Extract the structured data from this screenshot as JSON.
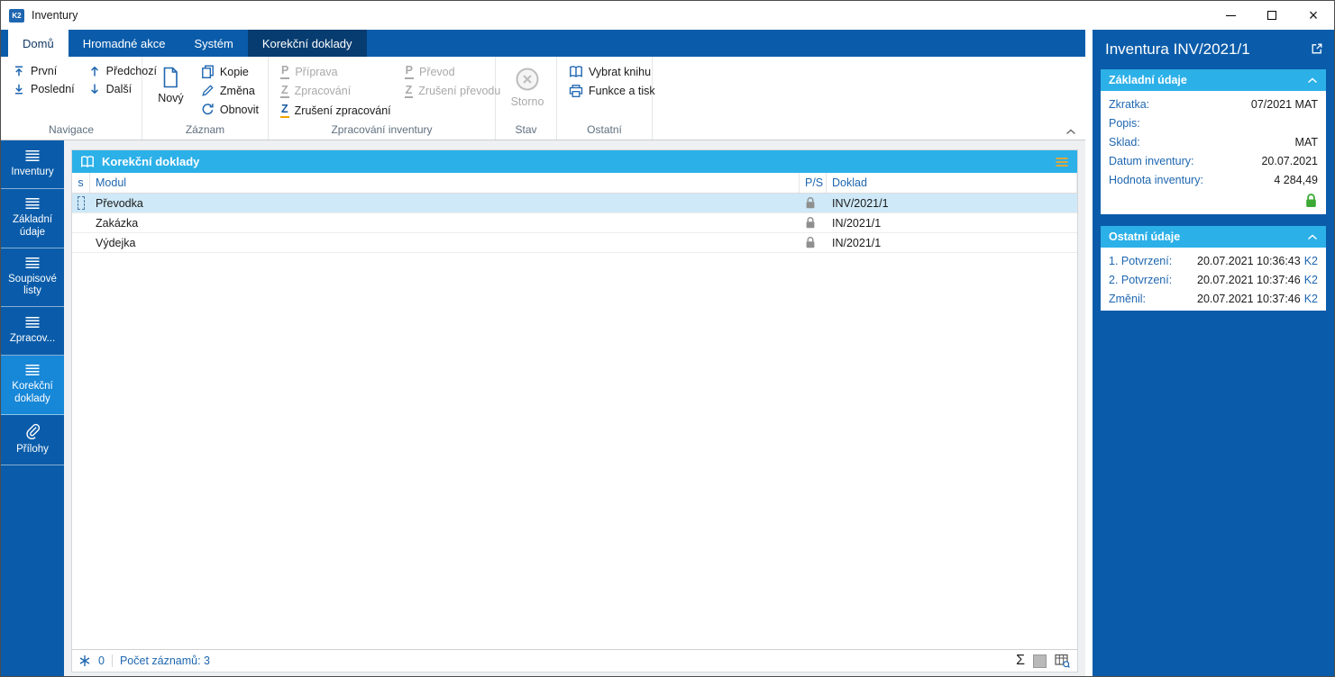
{
  "window": {
    "title": "Inventury"
  },
  "colors": {
    "primary_blue": "#0a5caa",
    "contextual_tab": "#063c70",
    "cyan_header": "#2cb0e8",
    "selected_row": "#cfe9f8",
    "link_blue": "#1e66b0",
    "sidebar_active": "#1787d8",
    "lock_green": "#3aaa35",
    "hamburger_orange": "#f5a623"
  },
  "icons": {
    "letter_p": "P",
    "letter_z": "Z",
    "sum": "Σ"
  },
  "tabs": [
    {
      "label": "Domů",
      "active": true
    },
    {
      "label": "Hromadné akce"
    },
    {
      "label": "Systém"
    },
    {
      "label": "Korekční doklady",
      "contextual": true
    }
  ],
  "ribbon": {
    "navigace": {
      "label": "Navigace",
      "first": "První",
      "last": "Poslední",
      "prev": "Předchozí",
      "next": "Další"
    },
    "zaznam": {
      "label": "Záznam",
      "novy": "Nový",
      "kopie": "Kopie",
      "zmena": "Změna",
      "obnovit": "Obnovit"
    },
    "zpracovani": {
      "label": "Zpracování inventury",
      "priprava": "Příprava",
      "zprac": "Zpracování",
      "zruseni_zprac": "Zrušení zpracování",
      "prevod": "Převod",
      "zruseni_prevodu": "Zrušení převodu"
    },
    "stav": {
      "label": "Stav",
      "storno": "Storno"
    },
    "ostatni": {
      "label": "Ostatní",
      "vybrat_knihu": "Vybrat knihu",
      "funkce_a_tisk": "Funkce a tisk"
    }
  },
  "sidebar": {
    "items": [
      {
        "label": "Inventury"
      },
      {
        "label": "Základní údaje"
      },
      {
        "label": "Soupisové listy"
      },
      {
        "label": "Zpracov..."
      },
      {
        "label": "Korekční doklady",
        "active": true
      },
      {
        "label": "Přílohy"
      }
    ]
  },
  "grid": {
    "title": "Korekční doklady",
    "columns": {
      "s": "s",
      "modul": "Modul",
      "ps": "P/S",
      "doklad": "Doklad"
    },
    "rows": [
      {
        "modul": "Převodka",
        "doklad": "INV/2021/1",
        "locked": true,
        "selected": true
      },
      {
        "modul": "Zakázka",
        "doklad": "IN/2021/1",
        "locked": true
      },
      {
        "modul": "Výdejka",
        "doklad": "IN/2021/1",
        "locked": true
      }
    ],
    "status": {
      "flag_count": "0",
      "records": "Počet záznamů: 3"
    }
  },
  "detail": {
    "title": "Inventura INV/2021/1",
    "sections": [
      {
        "header": "Základní údaje",
        "locked": true,
        "rows": [
          {
            "label": "Zkratka:",
            "value": "07/2021 MAT"
          },
          {
            "label": "Popis:",
            "value": ""
          },
          {
            "label": "Sklad:",
            "value": "MAT"
          },
          {
            "label": "Datum inventury:",
            "value": "20.07.2021"
          },
          {
            "label": "Hodnota inventury:",
            "value": "4 284,49"
          }
        ]
      },
      {
        "header": "Ostatní údaje",
        "rows": [
          {
            "label": "1. Potvrzení:",
            "value": "20.07.2021 10:36:43",
            "suffix": "K2"
          },
          {
            "label": "2. Potvrzení:",
            "value": "20.07.2021 10:37:46",
            "suffix": "K2"
          },
          {
            "label": "Změnil:",
            "value": "20.07.2021 10:37:46",
            "suffix": "K2"
          }
        ]
      }
    ]
  }
}
